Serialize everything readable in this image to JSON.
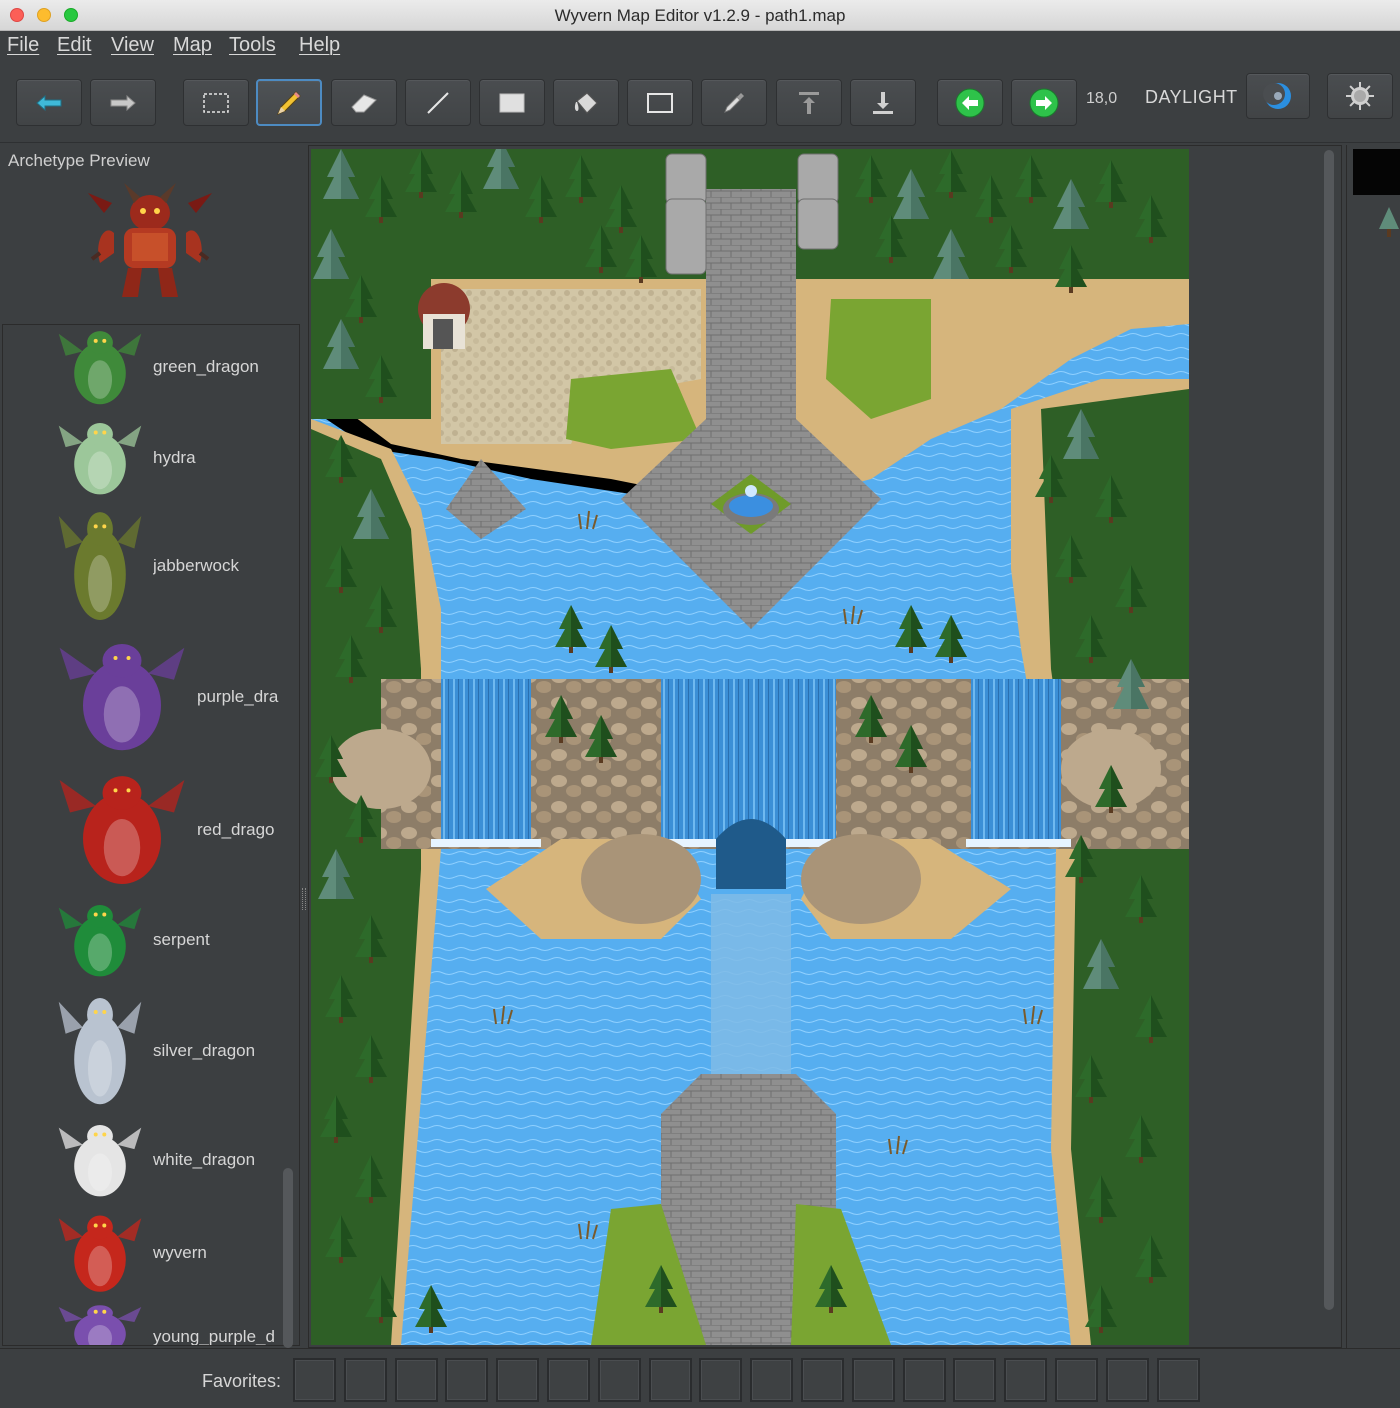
{
  "window": {
    "title": "Wyvern Map Editor v1.2.9 - path1.map"
  },
  "menu": {
    "items": [
      "File",
      "Edit",
      "View",
      "Map",
      "Tools",
      "Help"
    ]
  },
  "toolbar": {
    "buttons": [
      {
        "icon": "back-arrow-icon"
      },
      {
        "icon": "forward-arrow-icon"
      },
      {
        "icon": "select-rectangle-icon"
      },
      {
        "icon": "pencil-icon",
        "active": true
      },
      {
        "icon": "eraser-icon"
      },
      {
        "icon": "line-icon"
      },
      {
        "icon": "filled-rectangle-icon"
      },
      {
        "icon": "fill-bucket-icon"
      },
      {
        "icon": "rectangle-outline-icon"
      },
      {
        "icon": "eyedropper-icon"
      },
      {
        "icon": "raise-layer-icon"
      },
      {
        "icon": "lower-layer-icon"
      },
      {
        "icon": "previous-map-icon"
      },
      {
        "icon": "next-map-icon"
      }
    ],
    "coordinates": "18,0",
    "lighting_label": "DAYLIGHT",
    "lighting_icon": "moon-icon",
    "settings_icon": "sun-gear-icon"
  },
  "left_panel": {
    "preview_label": "Archetype Preview",
    "preview_sprite": "red-demon",
    "archetypes": [
      {
        "name": "green_dragon",
        "color": "#3f8a3a"
      },
      {
        "name": "hydra",
        "color": "#9cc79a"
      },
      {
        "name": "jabberwock",
        "color": "#6b7a2e"
      },
      {
        "name": "purple_dra",
        "color": "#6a3f9a"
      },
      {
        "name": "red_drago",
        "color": "#b8231c"
      },
      {
        "name": "serpent",
        "color": "#1f8c3a"
      },
      {
        "name": "silver_dragon",
        "color": "#b9c3d0"
      },
      {
        "name": "white_dragon",
        "color": "#e5e5e5"
      },
      {
        "name": "wyvern",
        "color": "#c5271c"
      },
      {
        "name": "young_purple_d",
        "color": "#7a4fae"
      }
    ]
  },
  "favorites": {
    "label": "Favorites:",
    "slot_count": 18
  },
  "colors": {
    "water": "#56aef0",
    "grass": "#6a9a2a",
    "sand": "#d6b57c",
    "stone": "#8e8e8e",
    "tree": "#2e5f26"
  }
}
